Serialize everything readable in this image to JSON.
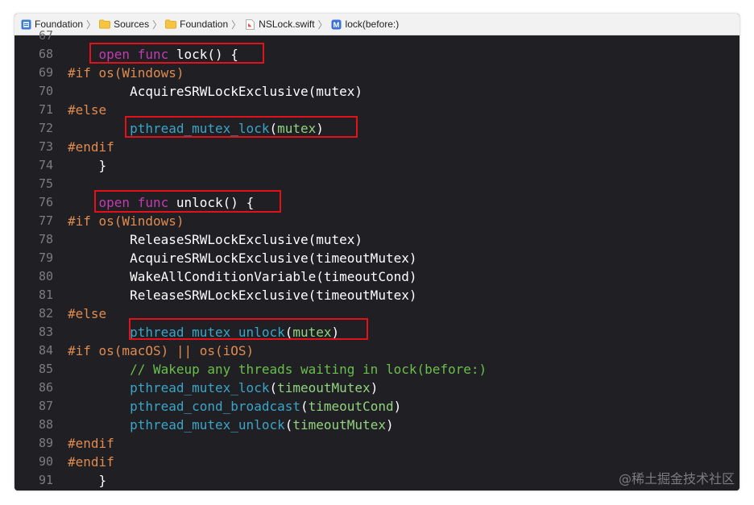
{
  "breadcrumb": [
    {
      "label": "Foundation",
      "icon": "project-icon"
    },
    {
      "label": "Sources",
      "icon": "folder-icon"
    },
    {
      "label": "Foundation",
      "icon": "folder-icon"
    },
    {
      "label": "NSLock.swift",
      "icon": "swift-file-icon"
    },
    {
      "label": "lock(before:)",
      "icon": "method-icon"
    }
  ],
  "separator": "〉",
  "partial_line_number": "67",
  "lines": [
    {
      "n": "68",
      "segs": [
        {
          "t": "    "
        },
        {
          "c": "kw",
          "t": "open"
        },
        {
          "t": " "
        },
        {
          "c": "kw",
          "t": "func"
        },
        {
          "t": " lock() {"
        }
      ]
    },
    {
      "n": "69",
      "segs": [
        {
          "c": "pp",
          "t": "#if os(Windows)"
        }
      ]
    },
    {
      "n": "70",
      "segs": [
        {
          "t": "        AcquireSRWLockExclusive(mutex)"
        }
      ]
    },
    {
      "n": "71",
      "segs": [
        {
          "c": "pp",
          "t": "#else"
        }
      ]
    },
    {
      "n": "72",
      "segs": [
        {
          "t": "        "
        },
        {
          "c": "fn",
          "t": "pthread_mutex_lock"
        },
        {
          "t": "("
        },
        {
          "c": "var",
          "t": "mutex"
        },
        {
          "t": ")"
        }
      ]
    },
    {
      "n": "73",
      "segs": [
        {
          "c": "pp",
          "t": "#endif"
        }
      ]
    },
    {
      "n": "74",
      "segs": [
        {
          "t": "    }"
        }
      ]
    },
    {
      "n": "75",
      "segs": [
        {
          "t": ""
        }
      ]
    },
    {
      "n": "76",
      "segs": [
        {
          "t": "    "
        },
        {
          "c": "kw",
          "t": "open"
        },
        {
          "t": " "
        },
        {
          "c": "kw",
          "t": "func"
        },
        {
          "t": " unlock() {"
        }
      ]
    },
    {
      "n": "77",
      "segs": [
        {
          "c": "pp",
          "t": "#if os(Windows)"
        }
      ]
    },
    {
      "n": "78",
      "segs": [
        {
          "t": "        ReleaseSRWLockExclusive(mutex)"
        }
      ]
    },
    {
      "n": "79",
      "segs": [
        {
          "t": "        AcquireSRWLockExclusive(timeoutMutex)"
        }
      ]
    },
    {
      "n": "80",
      "segs": [
        {
          "t": "        WakeAllConditionVariable(timeoutCond)"
        }
      ]
    },
    {
      "n": "81",
      "segs": [
        {
          "t": "        ReleaseSRWLockExclusive(timeoutMutex)"
        }
      ]
    },
    {
      "n": "82",
      "segs": [
        {
          "c": "pp",
          "t": "#else"
        }
      ]
    },
    {
      "n": "83",
      "segs": [
        {
          "t": "        "
        },
        {
          "c": "fn",
          "t": "pthread_mutex_unlock"
        },
        {
          "t": "("
        },
        {
          "c": "var",
          "t": "mutex"
        },
        {
          "t": ")"
        }
      ]
    },
    {
      "n": "84",
      "segs": [
        {
          "c": "pp",
          "t": "#if os(macOS) || os(iOS)"
        }
      ]
    },
    {
      "n": "85",
      "segs": [
        {
          "t": "        "
        },
        {
          "c": "cmt",
          "t": "// Wakeup any threads waiting in lock(before:)"
        }
      ]
    },
    {
      "n": "86",
      "segs": [
        {
          "t": "        "
        },
        {
          "c": "fn",
          "t": "pthread_mutex_lock"
        },
        {
          "t": "("
        },
        {
          "c": "var",
          "t": "timeoutMutex"
        },
        {
          "t": ")"
        }
      ]
    },
    {
      "n": "87",
      "segs": [
        {
          "t": "        "
        },
        {
          "c": "fn",
          "t": "pthread_cond_broadcast"
        },
        {
          "t": "("
        },
        {
          "c": "var",
          "t": "timeoutCond"
        },
        {
          "t": ")"
        }
      ]
    },
    {
      "n": "88",
      "segs": [
        {
          "t": "        "
        },
        {
          "c": "fn",
          "t": "pthread_mutex_unlock"
        },
        {
          "t": "("
        },
        {
          "c": "var",
          "t": "timeoutMutex"
        },
        {
          "t": ")"
        }
      ]
    },
    {
      "n": "89",
      "segs": [
        {
          "c": "pp",
          "t": "#endif"
        }
      ]
    },
    {
      "n": "90",
      "segs": [
        {
          "c": "pp",
          "t": "#endif"
        }
      ]
    },
    {
      "n": "91",
      "segs": [
        {
          "t": "    }"
        }
      ]
    }
  ],
  "highlight_color": "#e3121a",
  "watermark": "@稀土掘金技术社区"
}
